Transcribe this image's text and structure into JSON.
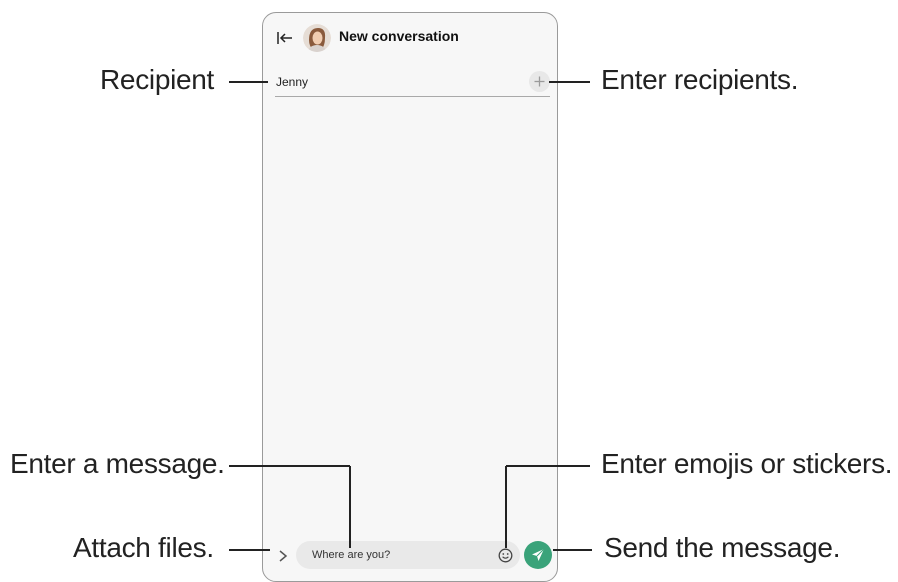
{
  "header": {
    "title": "New conversation"
  },
  "recipient": {
    "name": "Jenny"
  },
  "composer": {
    "message_text": "Where are you?"
  },
  "callouts": {
    "recipient": "Recipient",
    "enter_recipients": "Enter recipients.",
    "enter_message": "Enter a message.",
    "enter_emojis": "Enter emojis or stickers.",
    "attach_files": "Attach files.",
    "send_message": "Send the message."
  },
  "icons": {
    "back": "collapse-back-icon",
    "add_recipient": "plus-icon",
    "attach": "chevron-right-icon",
    "emoji": "smiley-icon",
    "send": "paper-plane-icon"
  },
  "colors": {
    "send_button": "#3aa37a",
    "screen_background": "#f7f7f7"
  }
}
